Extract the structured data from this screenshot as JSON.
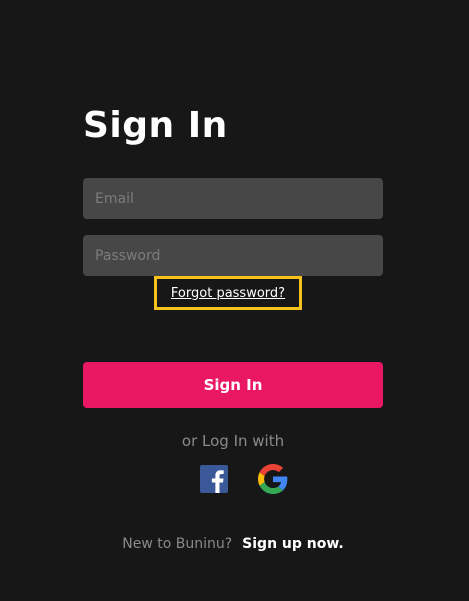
{
  "heading": "Sign In",
  "email": {
    "placeholder": "Email",
    "value": ""
  },
  "password": {
    "placeholder": "Password",
    "value": ""
  },
  "forgot_password_label": "Forgot password?",
  "sign_in_button_label": "Sign In",
  "social": {
    "label": "or Log In with",
    "providers": [
      {
        "icon": "facebook-icon"
      },
      {
        "icon": "google-icon"
      }
    ]
  },
  "signup": {
    "prompt": "New to Buninu?",
    "link_label": "Sign up now."
  },
  "colors": {
    "background": "#171717",
    "field_bg": "#474747",
    "accent": "#ea1763",
    "highlight": "#f4c21b",
    "facebook": "#3b5998"
  }
}
